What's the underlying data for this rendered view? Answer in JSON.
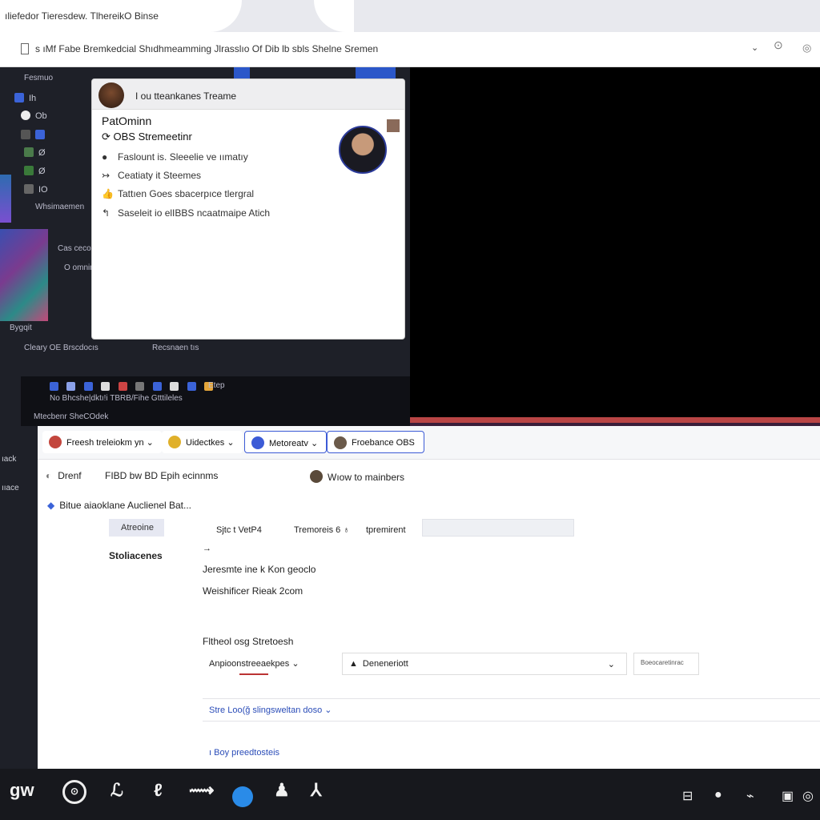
{
  "browser": {
    "tab_title": "ıliefedor Tieresdew. TlhereikO Binse",
    "address_title": "s ıMf Fabe Bremkedcial Shıdhmeamming Jlrasslıo Of Dib lb sbls Shelne Sremen",
    "chevron": "⌄",
    "pin_icon": "pin-icon",
    "lock_icon": "lock-icon"
  },
  "obs": {
    "menu_label": "Fesmuo",
    "rows": [
      "Ih",
      "Ob",
      "Ø",
      "Ø",
      "IO"
    ],
    "scene_label": "Whsimaemen",
    "source_label": "Cas cecox",
    "source_sub": "O omnim",
    "small_a": "Bygqit",
    "controls_a": "Cleary OE Brscdocıs",
    "controls_b": "Recsnaen tıs",
    "toolbar_text": "Etep",
    "toolbar_line": "No Bhcshe|dktı!i TBRB/Fihe Gtttileles",
    "footer": "Mtecbenr SheCOdek"
  },
  "popup": {
    "header": "I ou tteankanes Treame",
    "name": "PatOminn",
    "subtitle": "OBS Stremeetinr",
    "items": [
      {
        "bullet": "●",
        "text": "Faslount is. Sleeelie ve ıımatıy"
      },
      {
        "bullet": "↣",
        "text": "Ceatiaty it Steemes"
      },
      {
        "bullet": "👍",
        "text": "Tattıen Goes sbacerpıce tlergral"
      },
      {
        "bullet": "↰",
        "text": "Saseleit io elIBBS ncaatmaipe Atich"
      }
    ]
  },
  "sidebar": {
    "a": "ıack",
    "b": "ııace"
  },
  "panel": {
    "chips": [
      {
        "label": "Freesh treleiokm yn ⌄",
        "color": "#c3463d"
      },
      {
        "label": "Uidectkes ⌄",
        "color": "#e0b02a"
      },
      {
        "label": "Metoreatv ⌄",
        "color": "#3c5bd6"
      },
      {
        "label": "Froebance OBS",
        "color": "#6b5a4a"
      }
    ],
    "row2_a": "Drenf",
    "row2_b": "FIBD bw BD Epih ecinnms",
    "row2_c": "Wıow to mainbers",
    "section": "Bitue aiaoklane Auclienel Bat...",
    "tag": "Atreoine",
    "field_a": "Sjtc t VetP4",
    "field_b": "Tremoreis 6 ♁",
    "field_c": "tpremirent",
    "bold": "Stoliacenes",
    "small_toggle": "→",
    "line1": "Jeresmte ine k Kon geoclo",
    "line2": "Weishificer Rieak 2com",
    "group": "Fltheol osg Stretoesh",
    "dd1": "Anpioonstreeaekpes ⌄",
    "dd2": "Deneneriott",
    "dd3": "Boeocaretinrac",
    "link1": "Stre Loo(ğ slingsweltan doso ⌄",
    "link2": "ı Boy preedtosteis"
  },
  "taskbar": {
    "items": [
      "gw",
      "⊙",
      "ℒ",
      "ℓ",
      "⟿",
      "●",
      "♟",
      "⅄"
    ],
    "tray": [
      "⊟",
      "●",
      "⌁",
      "▣",
      "◎"
    ]
  }
}
